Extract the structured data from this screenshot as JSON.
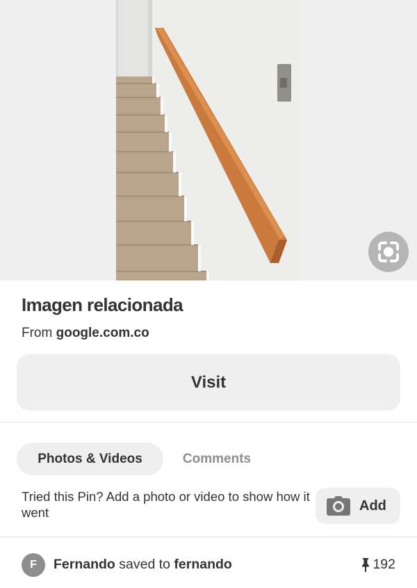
{
  "pin": {
    "image_alt": "Wooden handrail mounted on white wall beside carpeted staircase",
    "title": "Imagen relacionada",
    "source_prefix": "From",
    "source_domain": "google.com.co"
  },
  "actions": {
    "visit_label": "Visit",
    "lens_icon": "visual-search-icon"
  },
  "tabs": [
    {
      "label": "Photos & Videos",
      "active": true
    },
    {
      "label": "Comments",
      "active": false
    }
  ],
  "tried": {
    "prompt": "Tried this Pin? Add a photo or video to show how it went",
    "add_label": "Add",
    "add_icon": "camera-icon"
  },
  "saved": {
    "avatar_initial": "F",
    "user": "Fernando",
    "middle_text": "saved to",
    "board": "fernando",
    "pin_icon": "pushpin-icon",
    "save_count": "192"
  },
  "colors": {
    "background": "#ffffff",
    "surface": "#efefef",
    "text": "#333333",
    "muted": "#8e8e8e"
  }
}
